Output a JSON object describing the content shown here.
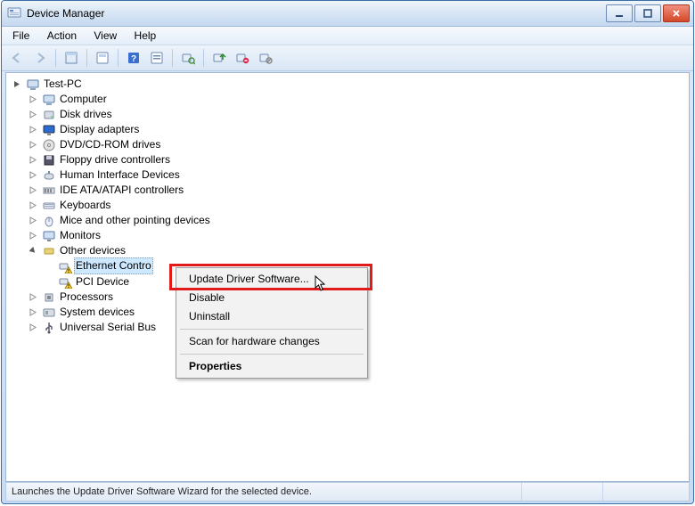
{
  "title": "Device Manager",
  "menu": {
    "file": "File",
    "action": "Action",
    "view": "View",
    "help": "Help"
  },
  "tree": {
    "root": "Test-PC",
    "items": [
      "Computer",
      "Disk drives",
      "Display adapters",
      "DVD/CD-ROM drives",
      "Floppy drive controllers",
      "Human Interface Devices",
      "IDE ATA/ATAPI controllers",
      "Keyboards",
      "Mice and other pointing devices",
      "Monitors"
    ],
    "other_label": "Other devices",
    "other_children": [
      "Ethernet Contro",
      "PCI Device"
    ],
    "after_other": [
      "Processors",
      "System devices",
      "Universal Serial Bus"
    ]
  },
  "ctx": {
    "update": "Update Driver Software...",
    "disable": "Disable",
    "uninstall": "Uninstall",
    "scan": "Scan for hardware changes",
    "properties": "Properties"
  },
  "status": "Launches the Update Driver Software Wizard for the selected device."
}
